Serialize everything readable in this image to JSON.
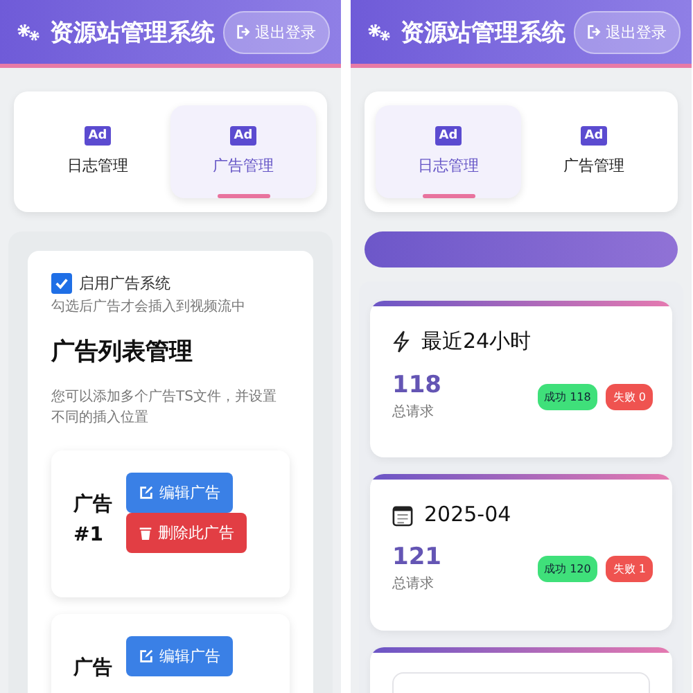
{
  "screens": [
    {
      "kind": "ads",
      "header": {
        "title": "资源站管理系统",
        "logout": "退出登录"
      },
      "tabs": [
        {
          "icon": "Ad",
          "label": "日志管理",
          "selected": false
        },
        {
          "icon": "Ad",
          "label": "广告管理",
          "selected": true
        }
      ],
      "enable": {
        "label": "启用广告系统",
        "checked": true,
        "hint": "勾选后广告才会插入到视频流中"
      },
      "section_title": "广告列表管理",
      "section_desc": "您可以添加多个广告TS文件，并设置不同的插入位置",
      "ads": [
        {
          "title": "广告 #1",
          "buttons": [
            {
              "kind": "edit",
              "label": "编辑广告"
            },
            {
              "kind": "delete",
              "label": "删除此广告"
            }
          ]
        },
        {
          "title": "广告",
          "buttons": [
            {
              "kind": "edit",
              "label": "编辑广告"
            }
          ]
        }
      ]
    },
    {
      "kind": "logs",
      "header": {
        "title": "资源站管理系统",
        "logout": "退出登录"
      },
      "tabs": [
        {
          "icon": "Ad",
          "label": "日志管理",
          "selected": true
        },
        {
          "icon": "Ad",
          "label": "广告管理",
          "selected": false
        }
      ],
      "stats": [
        {
          "kind": "recent",
          "title": "最近24小时",
          "total": "118",
          "total_label": "总请求",
          "chips": [
            {
              "kind": "success",
              "label": "成功 118"
            },
            {
              "kind": "fail",
              "label": "失败 0"
            }
          ]
        },
        {
          "kind": "month",
          "title": "2025-04",
          "total": "121",
          "total_label": "总请求",
          "chips": [
            {
              "kind": "success",
              "label": "成功 120"
            },
            {
              "kind": "fail",
              "label": "失败 1"
            }
          ]
        },
        {
          "kind": "empty"
        }
      ]
    }
  ]
}
